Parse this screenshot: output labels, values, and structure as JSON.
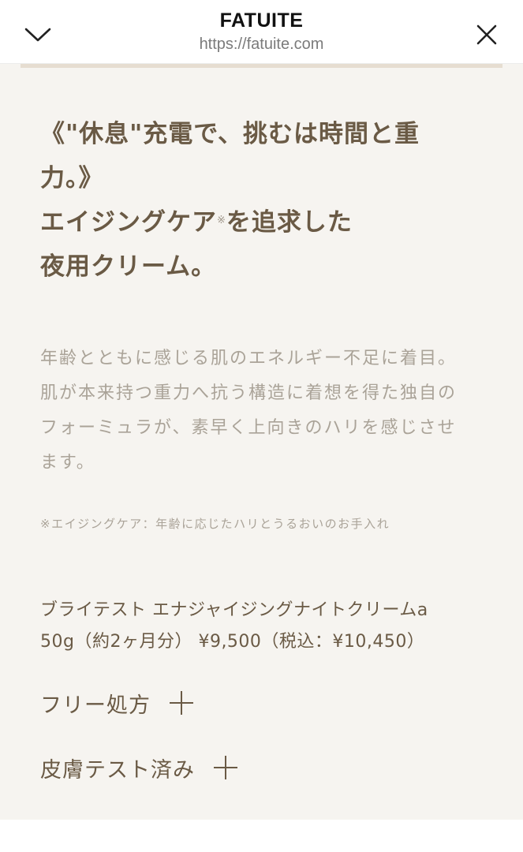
{
  "browser": {
    "title": "FATUITE",
    "url": "https://fatuite.com"
  },
  "headline": {
    "line1": "《\"休息\"充電で、挑むは時間と重",
    "line2": "力。》",
    "line3_a": "エイジングケア",
    "line3_mark": "※",
    "line3_b": "を追求した",
    "line4": "夜用クリーム。"
  },
  "description": {
    "line1": "年齢とともに感じる肌のエネルギー不足に着目。",
    "line2": "肌が本来持つ重力へ抗う構造に着想を得た独自の",
    "line3": "フォーミュラが、素早く上向きのハリを感じさせ",
    "line4": "ます。"
  },
  "note": "※エイジングケア：年齢に応じたハリとうるおいのお手入れ",
  "product": {
    "name": "ブライテスト エナジャイジングナイトクリームa",
    "price": "50g（約2ヶ月分） ¥9,500（税込：¥10,450）"
  },
  "features": [
    {
      "label": "フリー処方"
    },
    {
      "label": "皮膚テスト済み"
    }
  ],
  "colors": {
    "accent_text": "#6a5a45",
    "muted_text": "#aaa398",
    "background": "#f6f4f0"
  }
}
